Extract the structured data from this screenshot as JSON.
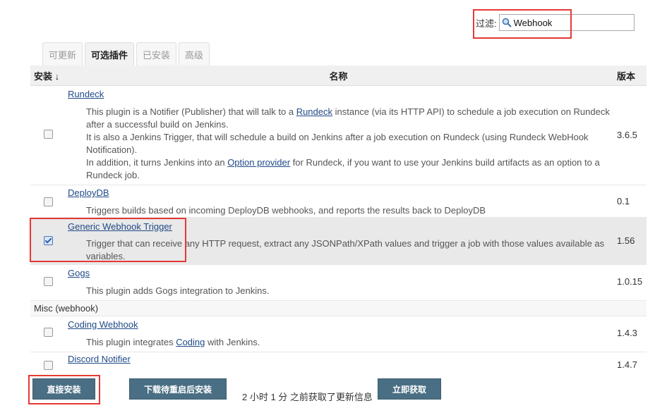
{
  "filter": {
    "label": "过滤:",
    "value": "Webhook"
  },
  "tabs": [
    {
      "label": "可更新",
      "active": false
    },
    {
      "label": "可选插件",
      "active": true
    },
    {
      "label": "已安装",
      "active": false
    },
    {
      "label": "高级",
      "active": false
    }
  ],
  "table": {
    "headers": {
      "install": "安装 ↓",
      "name": "名称",
      "version": "版本"
    },
    "rundeck": {
      "name": "Rundeck",
      "version": "3.6.5",
      "desc_1": "This plugin is a Notifier (Publisher) that will talk to a ",
      "desc_1_link": "Rundeck",
      "desc_1_rest": " instance (via its HTTP API) to schedule a job execution on Rundeck after a successful build on Jenkins.",
      "desc_2": "It is also a Jenkins Trigger, that will schedule a build on Jenkins after a job execution on Rundeck (using Rundeck WebHook Notification).",
      "desc_3": "In addition, it turns Jenkins into an ",
      "desc_3_link": "Option provider",
      "desc_3_rest": " for Rundeck, if you want to use your Jenkins build artifacts as an option to a Rundeck job."
    },
    "deploydb": {
      "name": "DeployDB",
      "version": "0.1",
      "desc": "Triggers builds based on incoming DeployDB webhooks, and reports the results back to DeployDB"
    },
    "generic": {
      "name": "Generic Webhook Trigger",
      "version": "1.56",
      "desc": "Trigger that can receive any HTTP request, extract any JSONPath/XPath values and trigger a job with those values available as variables."
    },
    "gogs": {
      "name": "Gogs",
      "version": "1.0.15",
      "desc": "This plugin adds Gogs integration to Jenkins."
    },
    "category": "Misc (webhook)",
    "coding": {
      "name": "Coding Webhook",
      "version": "1.4.3",
      "desc_pre": "This plugin integrates ",
      "desc_link": "Coding",
      "desc_post": " with Jenkins."
    },
    "discord": {
      "name": "Discord Notifier",
      "version": "1.4.7"
    }
  },
  "footer": {
    "install_now": "直接安装",
    "download_restart": "下载待重启后安装",
    "status": "2 小时 1 分 之前获取了更新信息",
    "check_now": "立即获取"
  },
  "colors": {
    "highlight": "#e53935",
    "button": "#4a6f84",
    "link": "#204a87"
  }
}
